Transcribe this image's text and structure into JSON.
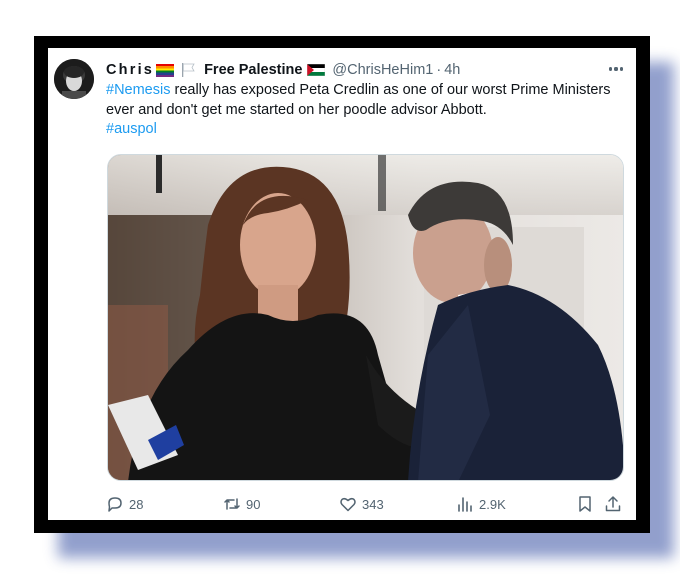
{
  "tweet": {
    "author_name": "Chris",
    "author_display": "Free Palestine",
    "handle": "@ChrisHeHim1",
    "separator": "·",
    "time": "4h",
    "text": {
      "hashtag1": "#Nemesis",
      "body": " really has exposed Peta Credlin as one of our worst Prime Ministers ever and don't get me started on her poodle advisor Abbott.",
      "hashtag2": "#auspol"
    },
    "icons": {
      "flags": [
        "rainbow-flag-icon",
        "white-flag-icon",
        "palestine-flag-icon"
      ],
      "menu": "more-icon"
    }
  },
  "actions": {
    "replies": "28",
    "reposts": "90",
    "likes": "343",
    "views": "2.9K",
    "icons": [
      "reply-icon",
      "repost-icon",
      "like-icon",
      "views-icon",
      "bookmark-icon",
      "share-icon"
    ]
  },
  "colors": {
    "accent": "#1d9bf0",
    "muted": "#536471",
    "text": "#0f1419",
    "frame": "#000000",
    "shadow": "#7f8fc4"
  }
}
